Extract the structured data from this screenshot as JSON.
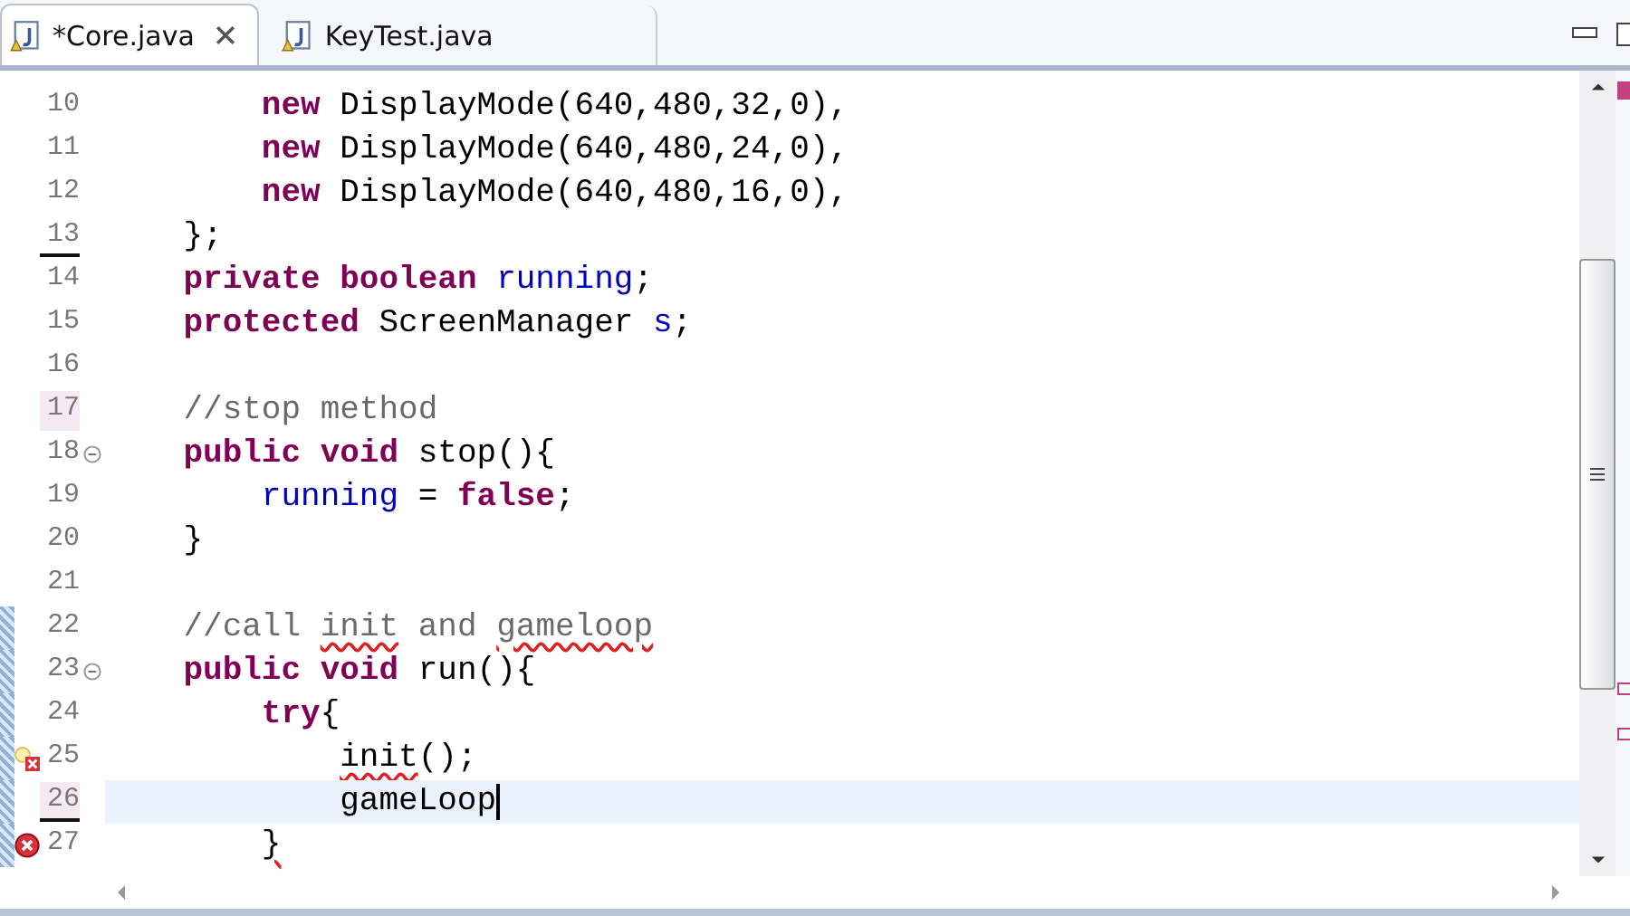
{
  "tabs": [
    {
      "label": "*Core.java",
      "selected": true,
      "closable": true
    },
    {
      "label": "KeyTest.java",
      "selected": false,
      "closable": false
    }
  ],
  "editor": {
    "lines": [
      {
        "number": "10",
        "kind": "plain",
        "fold": false,
        "changed": false,
        "current": false,
        "underlined": false,
        "highlighted": false,
        "tokens": [
          {
            "text": "        new",
            "kind": "keyword"
          },
          {
            "text": " DisplayMode(640,480,32,0),",
            "kind": "plain"
          }
        ]
      },
      {
        "number": "11",
        "kind": "plain",
        "fold": false,
        "changed": false,
        "current": false,
        "underlined": false,
        "highlighted": false,
        "tokens": [
          {
            "text": "        new",
            "kind": "keyword"
          },
          {
            "text": " DisplayMode(640,480,24,0),",
            "kind": "plain"
          }
        ]
      },
      {
        "number": "12",
        "kind": "plain",
        "fold": false,
        "changed": false,
        "current": false,
        "underlined": false,
        "highlighted": false,
        "tokens": [
          {
            "text": "        new",
            "kind": "keyword"
          },
          {
            "text": " DisplayMode(640,480,16,0),",
            "kind": "plain"
          }
        ]
      },
      {
        "number": "13",
        "kind": "plain",
        "fold": false,
        "changed": false,
        "current": false,
        "underlined": true,
        "highlighted": false,
        "tokens": [
          {
            "text": "    };",
            "kind": "plain"
          }
        ]
      },
      {
        "number": "14",
        "kind": "plain",
        "fold": false,
        "changed": false,
        "current": false,
        "underlined": false,
        "highlighted": false,
        "tokens": [
          {
            "text": "    private boolean",
            "kind": "keyword"
          },
          {
            "text": " running",
            "kind": "field"
          },
          {
            "text": ";",
            "kind": "plain"
          }
        ]
      },
      {
        "number": "15",
        "kind": "plain",
        "fold": false,
        "changed": false,
        "current": false,
        "underlined": false,
        "highlighted": false,
        "tokens": [
          {
            "text": "    protected",
            "kind": "keyword"
          },
          {
            "text": " ScreenManager ",
            "kind": "plain"
          },
          {
            "text": "s",
            "kind": "field"
          },
          {
            "text": ";",
            "kind": "plain"
          }
        ]
      },
      {
        "number": "16",
        "kind": "plain",
        "fold": false,
        "changed": false,
        "current": false,
        "underlined": false,
        "highlighted": false
      },
      {
        "number": "17",
        "kind": "plain",
        "fold": false,
        "changed": false,
        "current": false,
        "underlined": false,
        "highlighted": true,
        "tokens": [
          {
            "text": "    //stop method",
            "kind": "comment"
          }
        ]
      },
      {
        "number": "18",
        "kind": "plain",
        "fold": true,
        "changed": false,
        "current": false,
        "underlined": false,
        "highlighted": false,
        "tokens": [
          {
            "text": "    public void",
            "kind": "keyword"
          },
          {
            "text": " stop(){",
            "kind": "plain"
          }
        ]
      },
      {
        "number": "19",
        "kind": "plain",
        "fold": false,
        "changed": false,
        "current": false,
        "underlined": false,
        "highlighted": false,
        "tokens": [
          {
            "text": "        running",
            "kind": "field"
          },
          {
            "text": " = ",
            "kind": "plain"
          },
          {
            "text": "false",
            "kind": "keyword"
          },
          {
            "text": ";",
            "kind": "plain"
          }
        ]
      },
      {
        "number": "20",
        "kind": "plain",
        "fold": false,
        "changed": false,
        "current": false,
        "underlined": false,
        "highlighted": false,
        "tokens": [
          {
            "text": "    }",
            "kind": "plain"
          }
        ]
      },
      {
        "number": "21",
        "kind": "plain",
        "fold": false,
        "changed": false,
        "current": false,
        "underlined": false,
        "highlighted": false
      },
      {
        "number": "22",
        "kind": "plain",
        "fold": false,
        "changed": true,
        "current": false,
        "underlined": false,
        "highlighted": false,
        "tokens": [
          {
            "text": "    //call ",
            "kind": "comment"
          },
          {
            "text": "init",
            "kind": "comment-squiggle"
          },
          {
            "text": " and ",
            "kind": "comment"
          },
          {
            "text": "gameloop",
            "kind": "comment-squiggle"
          }
        ]
      },
      {
        "number": "23",
        "kind": "plain",
        "fold": true,
        "changed": true,
        "current": false,
        "underlined": false,
        "highlighted": false,
        "tokens": [
          {
            "text": "    public void",
            "kind": "keyword"
          },
          {
            "text": " run(){",
            "kind": "plain"
          }
        ]
      },
      {
        "number": "24",
        "kind": "plain",
        "fold": false,
        "changed": true,
        "current": false,
        "underlined": false,
        "highlighted": false,
        "tokens": [
          {
            "text": "        try",
            "kind": "keyword"
          },
          {
            "text": "{",
            "kind": "plain"
          }
        ]
      },
      {
        "number": "25",
        "kind": "quickfix-error",
        "fold": false,
        "changed": true,
        "current": false,
        "underlined": false,
        "highlighted": false,
        "tokens": [
          {
            "text": "            init",
            "kind": "plain-squiggle"
          },
          {
            "text": "();",
            "kind": "plain"
          }
        ]
      },
      {
        "number": "26",
        "kind": "plain",
        "fold": false,
        "changed": true,
        "current": true,
        "underlined": true,
        "highlighted": true,
        "tokens": [
          {
            "text": "            gameLoop",
            "kind": "plain"
          }
        ]
      },
      {
        "number": "27",
        "kind": "error",
        "fold": false,
        "changed": true,
        "current": false,
        "underlined": false,
        "highlighted": false,
        "tokens": [
          {
            "text": "        }",
            "kind": "plain-squiggle"
          }
        ]
      }
    ]
  }
}
